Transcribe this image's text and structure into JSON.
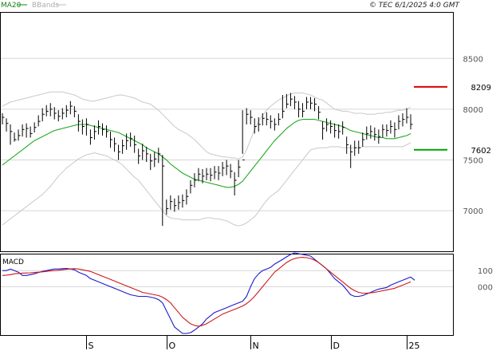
{
  "header": {
    "ma_legend": "MA20",
    "bb_legend": "BBands",
    "timestamp": "© TEC 6/1/2025 4:0 GMT"
  },
  "colors": {
    "ma": "#22aa22",
    "bands": "#c8c8c8",
    "price": "#000000",
    "macd": "#1a1acc",
    "signal": "#cc1a1a",
    "resistance": "#dd0000",
    "support": "#00a000",
    "grid": "#d6d6d6"
  },
  "chart_data": [
    {
      "type": "line",
      "panel": "price",
      "y_ticks": [
        "8500",
        "8000",
        "7500",
        "7000"
      ],
      "y_tick_values": [
        8500,
        8000,
        7500,
        7000
      ],
      "ylim": [
        6600,
        8950
      ],
      "x_tick_labels": [
        "S",
        "O",
        "N",
        "D",
        "25"
      ],
      "x_tick_index": [
        21,
        41,
        62,
        82,
        101
      ],
      "x_count": 103,
      "legend": [
        "MA20",
        "BBands"
      ],
      "levels": [
        {
          "label": "8209",
          "value": 8220,
          "kind": "resistance"
        },
        {
          "label": "7602",
          "value": 7600,
          "kind": "support"
        }
      ],
      "series": [
        {
          "name": "price",
          "values": [
            7920,
            7860,
            7780,
            7700,
            7740,
            7800,
            7810,
            7760,
            7820,
            7880,
            7950,
            7980,
            8000,
            7960,
            7930,
            7960,
            7990,
            8030,
            7980,
            7880,
            7830,
            7850,
            7720,
            7780,
            7830,
            7800,
            7780,
            7700,
            7660,
            7580,
            7640,
            7690,
            7710,
            7650,
            7540,
            7590,
            7560,
            7490,
            7510,
            7560,
            7440,
            7020,
            7090,
            7050,
            7080,
            7100,
            7140,
            7250,
            7300,
            7360,
            7340,
            7360,
            7350,
            7380,
            7370,
            7420,
            7440,
            7390,
            7300,
            7430,
            7500,
            7950,
            7920,
            7830,
            7850,
            7910,
            7900,
            7880,
            7850,
            7900,
            7980,
            8050,
            8100,
            8070,
            8000,
            7980,
            8070,
            8060,
            8050,
            7970,
            7810,
            7850,
            7830,
            7790,
            7780,
            7820,
            7650,
            7580,
            7620,
            7620,
            7700,
            7760,
            7780,
            7750,
            7730,
            7800,
            7790,
            7830,
            7800,
            7880,
            7900,
            7920,
            7850
          ],
          "lows": [
            7850,
            7780,
            7650,
            7680,
            7690,
            7730,
            7720,
            7720,
            7770,
            7830,
            7880,
            7930,
            7930,
            7900,
            7880,
            7900,
            7920,
            7950,
            7920,
            7780,
            7750,
            7740,
            7650,
            7700,
            7750,
            7740,
            7720,
            7620,
            7580,
            7500,
            7560,
            7600,
            7630,
            7570,
            7460,
            7500,
            7480,
            7400,
            7430,
            7470,
            6850,
            6960,
            7010,
            6990,
            7010,
            7030,
            7060,
            7170,
            7230,
            7290,
            7270,
            7300,
            7290,
            7310,
            7300,
            7340,
            7350,
            7320,
            7150,
            7330,
            7560,
            7850,
            7850,
            7760,
            7780,
            7840,
            7840,
            7810,
            7790,
            7840,
            7910,
            8010,
            8030,
            8000,
            7920,
            7920,
            8000,
            8000,
            7980,
            7900,
            7700,
            7780,
            7760,
            7720,
            7710,
            7750,
            7560,
            7420,
            7540,
            7560,
            7630,
            7700,
            7710,
            7690,
            7660,
            7720,
            7730,
            7760,
            7720,
            7800,
            7830,
            7860,
            7800
          ],
          "highs": [
            7960,
            7910,
            7850,
            7770,
            7800,
            7850,
            7860,
            7830,
            7870,
            7940,
            8010,
            8040,
            8060,
            8020,
            7990,
            8010,
            8040,
            8080,
            8030,
            7950,
            7900,
            7910,
            7800,
            7840,
            7890,
            7860,
            7840,
            7780,
            7720,
            7650,
            7700,
            7760,
            7770,
            7740,
            7610,
            7660,
            7630,
            7560,
            7580,
            7620,
            7550,
            7110,
            7150,
            7120,
            7150,
            7160,
            7210,
            7300,
            7370,
            7420,
            7410,
            7420,
            7420,
            7440,
            7440,
            7480,
            7500,
            7460,
            7380,
            7500,
            7990,
            8010,
            7990,
            7910,
            7920,
            7960,
            7970,
            7940,
            7910,
            7960,
            8140,
            8150,
            8160,
            8130,
            8080,
            8060,
            8120,
            8120,
            8110,
            8030,
            7880,
            7910,
            7890,
            7860,
            7850,
            7880,
            7730,
            7650,
            7690,
            7690,
            7770,
            7830,
            7840,
            7820,
            7800,
            7850,
            7850,
            7890,
            7870,
            7940,
            7960,
            8010,
            7950
          ]
        },
        {
          "name": "MA20",
          "values": [
            7450,
            7480,
            7510,
            7540,
            7570,
            7600,
            7630,
            7660,
            7690,
            7710,
            7730,
            7750,
            7770,
            7790,
            7800,
            7810,
            7820,
            7830,
            7840,
            7850,
            7850,
            7850,
            7840,
            7830,
            7820,
            7810,
            7800,
            7790,
            7780,
            7770,
            7750,
            7730,
            7710,
            7690,
            7670,
            7650,
            7620,
            7600,
            7580,
            7560,
            7530,
            7500,
            7460,
            7430,
            7400,
            7370,
            7350,
            7330,
            7310,
            7300,
            7290,
            7280,
            7270,
            7260,
            7250,
            7240,
            7230,
            7230,
            7240,
            7260,
            7290,
            7340,
            7390,
            7440,
            7490,
            7540,
            7590,
            7640,
            7690,
            7730,
            7770,
            7810,
            7840,
            7870,
            7890,
            7900,
            7900,
            7900,
            7900,
            7890,
            7880,
            7870,
            7860,
            7850,
            7840,
            7830,
            7810,
            7790,
            7780,
            7770,
            7760,
            7750,
            7740,
            7730,
            7720,
            7720,
            7710,
            7710,
            7710,
            7720,
            7730,
            7740,
            7760
          ]
        },
        {
          "name": "BBands upper",
          "values": [
            8030,
            8050,
            8070,
            8080,
            8090,
            8100,
            8110,
            8120,
            8130,
            8140,
            8150,
            8160,
            8170,
            8170,
            8170,
            8170,
            8160,
            8150,
            8140,
            8120,
            8100,
            8090,
            8080,
            8080,
            8090,
            8100,
            8110,
            8120,
            8130,
            8140,
            8140,
            8130,
            8120,
            8110,
            8090,
            8070,
            8060,
            8050,
            8020,
            7990,
            7950,
            7910,
            7870,
            7830,
            7800,
            7780,
            7760,
            7730,
            7700,
            7660,
            7620,
            7580,
            7560,
            7550,
            7540,
            7530,
            7530,
            7520,
            7520,
            7510,
            7530,
            7600,
            7700,
            7800,
            7880,
            7940,
            7990,
            8030,
            8060,
            8090,
            8110,
            8130,
            8150,
            8160,
            8160,
            8160,
            8150,
            8140,
            8120,
            8100,
            8090,
            8060,
            8030,
            8000,
            7990,
            7980,
            7980,
            7970,
            7960,
            7960,
            7960,
            7950,
            7950,
            7950,
            7960,
            7960,
            7970,
            7970,
            7980,
            7990,
            7990,
            8000,
            8020
          ]
        },
        {
          "name": "BBands lower",
          "values": [
            6860,
            6890,
            6920,
            6950,
            6980,
            7010,
            7040,
            7070,
            7100,
            7130,
            7160,
            7200,
            7240,
            7290,
            7340,
            7380,
            7420,
            7450,
            7480,
            7510,
            7530,
            7550,
            7560,
            7570,
            7560,
            7550,
            7540,
            7520,
            7500,
            7480,
            7450,
            7410,
            7370,
            7330,
            7300,
            7250,
            7200,
            7150,
            7100,
            7050,
            7000,
            6950,
            6930,
            6920,
            6920,
            6910,
            6910,
            6910,
            6910,
            6910,
            6920,
            6930,
            6930,
            6920,
            6920,
            6910,
            6900,
            6880,
            6860,
            6850,
            6860,
            6880,
            6910,
            6940,
            6990,
            7050,
            7100,
            7140,
            7170,
            7200,
            7250,
            7300,
            7350,
            7400,
            7450,
            7500,
            7550,
            7600,
            7610,
            7620,
            7620,
            7620,
            7630,
            7630,
            7630,
            7620,
            7620,
            7620,
            7620,
            7620,
            7630,
            7630,
            7630,
            7630,
            7630,
            7630,
            7630,
            7630,
            7630,
            7630,
            7630,
            7650,
            7670
          ]
        }
      ]
    },
    {
      "type": "line",
      "panel": "indicator",
      "title": "MACD",
      "y_ticks": [
        "100",
        "000"
      ],
      "y_tick_values": [
        100,
        0
      ],
      "ylim": [
        -300,
        200
      ],
      "series": [
        {
          "name": "MACD",
          "values": [
            100,
            100,
            110,
            100,
            90,
            70,
            70,
            75,
            80,
            88,
            95,
            100,
            105,
            110,
            110,
            112,
            113,
            110,
            105,
            90,
            80,
            70,
            50,
            40,
            30,
            20,
            10,
            0,
            -10,
            -20,
            -30,
            -40,
            -50,
            -55,
            -60,
            -60,
            -60,
            -65,
            -70,
            -80,
            -100,
            -150,
            -200,
            -250,
            -270,
            -290,
            -290,
            -285,
            -270,
            -250,
            -230,
            -200,
            -180,
            -160,
            -150,
            -140,
            -130,
            -120,
            -110,
            -100,
            -90,
            -60,
            0,
            50,
            80,
            100,
            110,
            120,
            140,
            155,
            170,
            185,
            200,
            210,
            205,
            200,
            195,
            190,
            170,
            150,
            130,
            110,
            80,
            50,
            30,
            10,
            -20,
            -50,
            -60,
            -60,
            -55,
            -45,
            -35,
            -25,
            -15,
            -10,
            -5,
            10,
            20,
            30,
            40,
            50,
            60,
            40
          ]
        },
        {
          "name": "Signal",
          "values": [
            70,
            72,
            75,
            80,
            82,
            84,
            85,
            86,
            88,
            90,
            92,
            95,
            98,
            100,
            102,
            105,
            108,
            110,
            112,
            110,
            105,
            100,
            95,
            85,
            75,
            65,
            55,
            45,
            35,
            25,
            15,
            5,
            -5,
            -15,
            -25,
            -35,
            -40,
            -45,
            -50,
            -55,
            -65,
            -80,
            -100,
            -130,
            -160,
            -190,
            -210,
            -230,
            -240,
            -245,
            -240,
            -230,
            -215,
            -200,
            -185,
            -170,
            -160,
            -150,
            -140,
            -130,
            -120,
            -105,
            -85,
            -60,
            -30,
            0,
            30,
            60,
            90,
            110,
            130,
            150,
            165,
            175,
            180,
            182,
            180,
            175,
            165,
            150,
            130,
            110,
            90,
            70,
            50,
            30,
            10,
            -10,
            -25,
            -35,
            -40,
            -40,
            -38,
            -35,
            -30,
            -25,
            -20,
            -15,
            -10,
            0,
            10,
            20,
            30
          ]
        }
      ]
    }
  ]
}
